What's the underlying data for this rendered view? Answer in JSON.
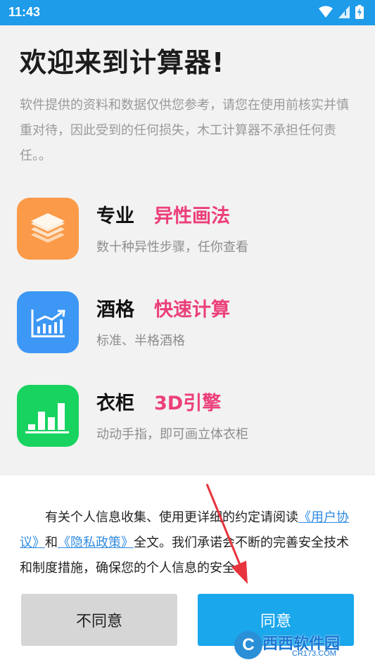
{
  "status_bar": {
    "time": "11:43",
    "icons": [
      "wifi-icon",
      "signal-icon",
      "battery-charging-icon"
    ]
  },
  "welcome": {
    "title": "欢迎来到计算器!",
    "intro": "软件提供的资料和数据仅供您参考，请您在使用前核实并慎重对待，因此受到的任何损失，木工计算器不承担任何责任。。"
  },
  "features": [
    {
      "name": "专业",
      "tagline": "异性画法",
      "desc": "数十种异性步骤，任你查看",
      "icon": "layers-icon",
      "color": "#fb9a48"
    },
    {
      "name": "酒格",
      "tagline": "快速计算",
      "desc": "标准、半格酒格",
      "icon": "chart-trend-icon",
      "color": "#3d97f4"
    },
    {
      "name": "衣柜",
      "tagline": "3D引擎",
      "desc": "动动手指，即可画立体衣柜",
      "icon": "bar-chart-icon",
      "color": "#18d360"
    }
  ],
  "consent": {
    "text_before": "有关个人信息收集、使用更详细的约定请阅读",
    "user_agreement_link": "《用户协议》",
    "text_and": "和",
    "privacy_link": "《隐私政策》",
    "text_after": "全文。我们承诺会不断的完善安全技术和制度措施，确保您的个人信息的安全。",
    "decline_label": "不同意",
    "agree_label": "同意"
  },
  "watermark": {
    "logo_letter": "C",
    "brand": "西西软件园",
    "site": "CR173.COM"
  },
  "colors": {
    "status_bar": "#1e9be9",
    "accent_pink": "#ec3f7b",
    "link": "#2f8be0",
    "agree_button": "#1aa7ec",
    "arrow": "#e8343c"
  }
}
